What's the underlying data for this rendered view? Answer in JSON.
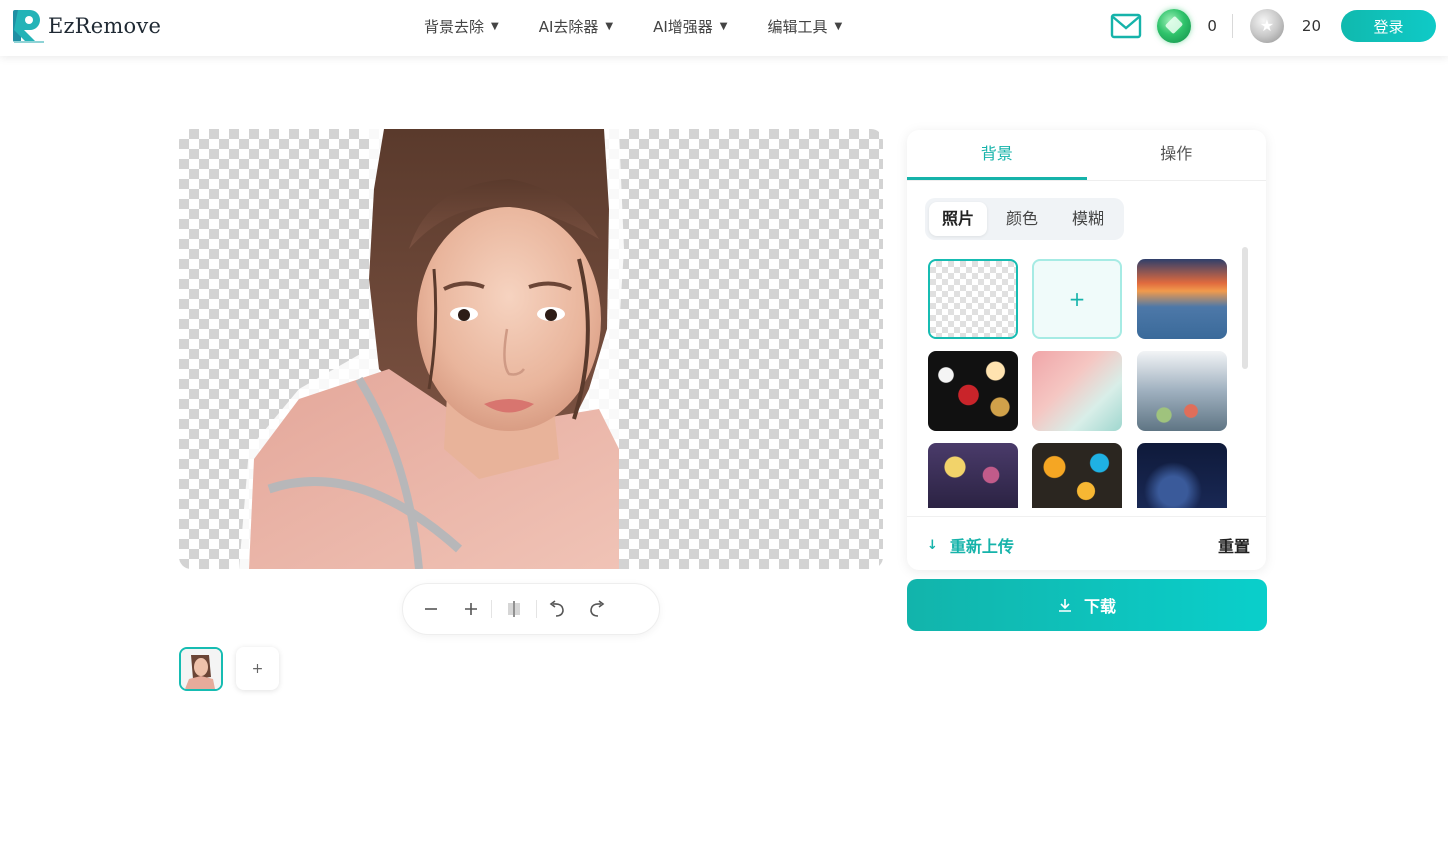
{
  "header": {
    "logo_text": "EzRemove",
    "nav": [
      {
        "label": "背景去除"
      },
      {
        "label": "AI去除器"
      },
      {
        "label": "AI增强器"
      },
      {
        "label": "编辑工具"
      }
    ],
    "gem_count": "0",
    "coin_count": "20",
    "login_label": "登录"
  },
  "panel": {
    "tabs": [
      "背景",
      "操作"
    ],
    "active_tab": 0,
    "segments": [
      "照片",
      "颜色",
      "模糊"
    ],
    "active_segment": 0,
    "add_symbol": "+",
    "reupload_label": "重新上传",
    "reset_label": "重置"
  },
  "download_label": "下载",
  "thumb_add_symbol": "+",
  "colors": {
    "accent": "#16b3aa",
    "accent_gradient_end": "#0acfcb"
  }
}
